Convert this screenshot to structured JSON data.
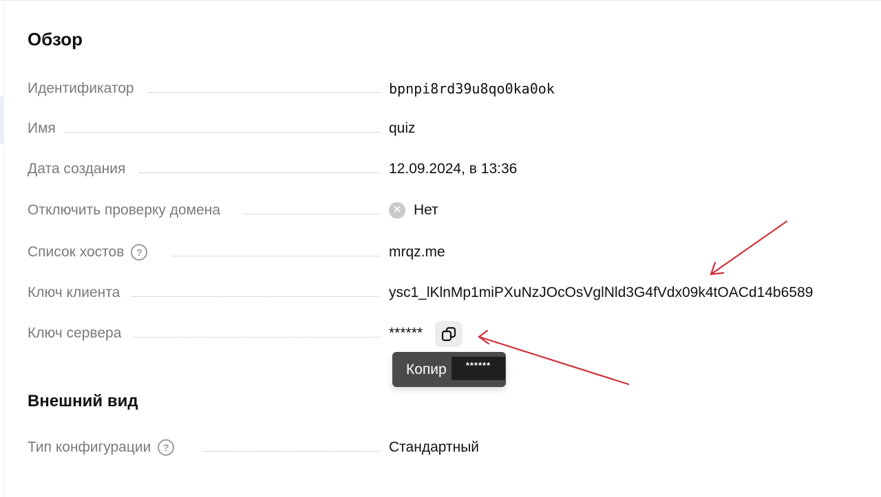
{
  "overview": {
    "title": "Обзор",
    "rows": {
      "id": {
        "label": "Идентификатор",
        "value": "bpnpi8rd39u8qo0ka0ok"
      },
      "name": {
        "label": "Имя",
        "value": "quiz"
      },
      "created": {
        "label": "Дата создания",
        "value": "12.09.2024, в 13:36"
      },
      "disable_domain_check": {
        "label": "Отключить проверку домена",
        "value": "Нет",
        "icon": "x-circle-icon"
      },
      "hosts": {
        "label": "Список хостов",
        "help": "?",
        "value": "mrqz.me"
      },
      "client_key": {
        "label": "Ключ клиента",
        "value": "ysc1_lKlnMp1miPXuNzJOcOsVglNld3G4fVdx09k4tOACd14b6589"
      },
      "server_key": {
        "label": "Ключ сервера",
        "value": "******",
        "copy_icon": "copy-icon"
      }
    },
    "tooltip": {
      "text": "Копир",
      "overlay": "******"
    }
  },
  "appearance": {
    "title": "Внешний вид",
    "rows": {
      "config_type": {
        "label": "Тип конфигурации",
        "help": "?",
        "value": "Стандартный"
      }
    }
  },
  "colors": {
    "annotation_arrow": "#d0303a",
    "label": "#7a7a7a",
    "tooltip_bg": "#4a4a4a"
  }
}
